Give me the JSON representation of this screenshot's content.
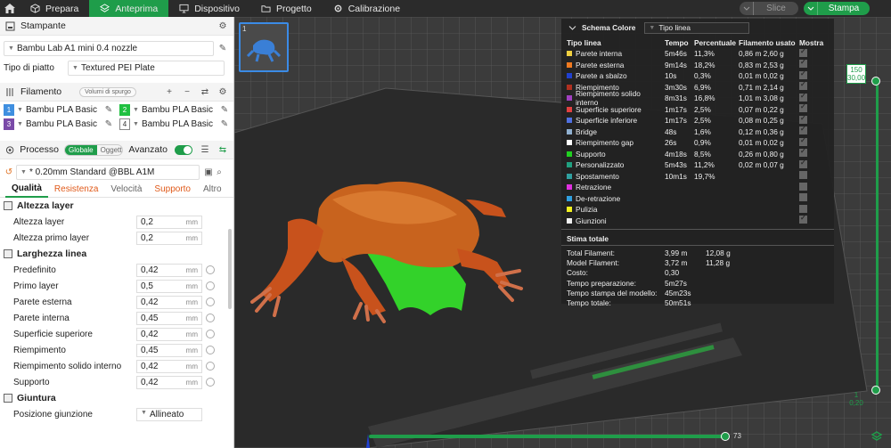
{
  "topbar": {
    "tabs": [
      {
        "label": "Prepara"
      },
      {
        "label": "Anteprima"
      },
      {
        "label": "Dispositivo"
      },
      {
        "label": "Progetto"
      },
      {
        "label": "Calibrazione"
      }
    ],
    "slice": "Slice",
    "print": "Stampa"
  },
  "printer": {
    "title": "Stampante",
    "name": "Bambu Lab A1 mini 0.4 nozzle",
    "plate_label": "Tipo di piatto",
    "plate": "Textured PEI Plate"
  },
  "filament": {
    "title": "Filamento",
    "purge": "Volumi di spurgo",
    "items": [
      {
        "num": "1",
        "name": "Bambu PLA Basic",
        "color": "#3f8fe0"
      },
      {
        "num": "2",
        "name": "Bambu PLA Basic",
        "color": "#20c040"
      },
      {
        "num": "3",
        "name": "Bambu PLA Basic",
        "color": "#7a4aa8"
      },
      {
        "num": "4",
        "name": "Bambu PLA Basic",
        "color": "#ffffff"
      }
    ]
  },
  "process": {
    "title": "Processo",
    "global": "Globale",
    "objects": "Oggetti",
    "advanced": "Avanzato",
    "profile": "* 0.20mm Standard @BBL A1M",
    "tabs": [
      "Qualità",
      "Resistenza",
      "Velocità",
      "Supporto",
      "Altro"
    ],
    "groups": [
      {
        "title": "Altezza layer",
        "params": [
          {
            "label": "Altezza layer",
            "value": "0,2",
            "unit": "mm"
          },
          {
            "label": "Altezza primo layer",
            "value": "0,2",
            "unit": "mm"
          }
        ]
      },
      {
        "title": "Larghezza linea",
        "params": [
          {
            "label": "Predefinito",
            "value": "0,42",
            "unit": "mm"
          },
          {
            "label": "Primo layer",
            "value": "0,5",
            "unit": "mm"
          },
          {
            "label": "Parete esterna",
            "value": "0,42",
            "unit": "mm"
          },
          {
            "label": "Parete interna",
            "value": "0,45",
            "unit": "mm"
          },
          {
            "label": "Superficie superiore",
            "value": "0,42",
            "unit": "mm"
          },
          {
            "label": "Riempimento",
            "value": "0,45",
            "unit": "mm"
          },
          {
            "label": "Riempimento solido interno",
            "value": "0,42",
            "unit": "mm"
          },
          {
            "label": "Supporto",
            "value": "0,42",
            "unit": "mm"
          }
        ]
      },
      {
        "title": "Giuntura",
        "params": [
          {
            "label": "Posizione giunzione",
            "value": "Allineato",
            "unit": ""
          }
        ]
      }
    ]
  },
  "plate_thumb": {
    "num": "1"
  },
  "legend": {
    "title": "Schema Colore",
    "mode": "Tipo linea",
    "headers": [
      "Tipo linea",
      "Tempo",
      "Percentuale",
      "Filamento usato",
      "Mostra"
    ],
    "rows": [
      {
        "name": "Parete interna",
        "time": "5m46s",
        "pct": "11,3%",
        "fil": "0,86 m  2,60 g",
        "color": "#f0d040",
        "show": true
      },
      {
        "name": "Parete esterna",
        "time": "9m14s",
        "pct": "18,2%",
        "fil": "0,83 m  2,53 g",
        "color": "#f07a20",
        "show": true
      },
      {
        "name": "Parete a sbalzo",
        "time": "10s",
        "pct": "0,3%",
        "fil": "0,01 m  0,02 g",
        "color": "#2040d0",
        "show": true
      },
      {
        "name": "Riempimento",
        "time": "3m30s",
        "pct": "6,9%",
        "fil": "0,71 m  2,14 g",
        "color": "#b03020",
        "show": true
      },
      {
        "name": "Riempimento solido interno",
        "time": "8m31s",
        "pct": "16,8%",
        "fil": "1,01 m  3,08 g",
        "color": "#a040c0",
        "show": true
      },
      {
        "name": "Superficie superiore",
        "time": "1m17s",
        "pct": "2,5%",
        "fil": "0,07 m  0,22 g",
        "color": "#e04040",
        "show": true
      },
      {
        "name": "Superficie inferiore",
        "time": "1m17s",
        "pct": "2,5%",
        "fil": "0,08 m  0,25 g",
        "color": "#5070e0",
        "show": true
      },
      {
        "name": "Bridge",
        "time": "48s",
        "pct": "1,6%",
        "fil": "0,12 m  0,36 g",
        "color": "#90b0d0",
        "show": true
      },
      {
        "name": "Riempimento gap",
        "time": "26s",
        "pct": "0,9%",
        "fil": "0,01 m  0,02 g",
        "color": "#ffffff",
        "show": true
      },
      {
        "name": "Supporto",
        "time": "4m18s",
        "pct": "8,5%",
        "fil": "0,26 m  0,80 g",
        "color": "#20d020",
        "show": true
      },
      {
        "name": "Personalizzato",
        "time": "5m43s",
        "pct": "11,2%",
        "fil": "0,02 m  0,07 g",
        "color": "#20a080",
        "show": true
      },
      {
        "name": "Spostamento",
        "time": "10m1s",
        "pct": "19,7%",
        "fil": "",
        "color": "#30a0a0",
        "show": false
      },
      {
        "name": "Retrazione",
        "time": "",
        "pct": "",
        "fil": "",
        "color": "#e030e0",
        "show": false
      },
      {
        "name": "De-retrazione",
        "time": "",
        "pct": "",
        "fil": "",
        "color": "#30a0e0",
        "show": false
      },
      {
        "name": "Pulizia",
        "time": "",
        "pct": "",
        "fil": "",
        "color": "#f0f020",
        "show": false
      },
      {
        "name": "Giunzioni",
        "time": "",
        "pct": "",
        "fil": "",
        "color": "#f0f0f0",
        "show": true
      }
    ],
    "total_title": "Stima totale",
    "totals": [
      {
        "label": "Total Filament:",
        "v1": "3,99 m",
        "v2": "12,08 g"
      },
      {
        "label": "Model Filament:",
        "v1": "3,72 m",
        "v2": "11,28 g"
      },
      {
        "label": "Costo:",
        "v1": "0,30",
        "v2": ""
      },
      {
        "label": "Tempo preparazione:",
        "v1": "5m27s",
        "v2": ""
      },
      {
        "label": "Tempo stampa del modello:",
        "v1": "45m23s",
        "v2": ""
      },
      {
        "label": "Tempo totale:",
        "v1": "50m51s",
        "v2": ""
      }
    ]
  },
  "layer_slider": {
    "top_layer": "150",
    "top_height": "30,00",
    "bottom_layer": "1",
    "bottom_height": "0,20"
  },
  "move_slider": {
    "value": "73"
  }
}
